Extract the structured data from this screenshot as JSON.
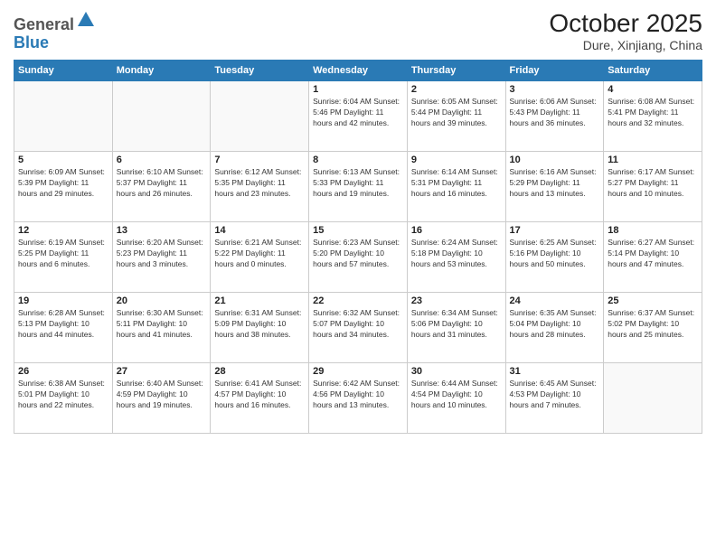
{
  "header": {
    "logo_general": "General",
    "logo_blue": "Blue",
    "month": "October 2025",
    "location": "Dure, Xinjiang, China"
  },
  "weekdays": [
    "Sunday",
    "Monday",
    "Tuesday",
    "Wednesday",
    "Thursday",
    "Friday",
    "Saturday"
  ],
  "weeks": [
    [
      {
        "day": "",
        "text": ""
      },
      {
        "day": "",
        "text": ""
      },
      {
        "day": "",
        "text": ""
      },
      {
        "day": "1",
        "text": "Sunrise: 6:04 AM\nSunset: 5:46 PM\nDaylight: 11 hours and 42 minutes."
      },
      {
        "day": "2",
        "text": "Sunrise: 6:05 AM\nSunset: 5:44 PM\nDaylight: 11 hours and 39 minutes."
      },
      {
        "day": "3",
        "text": "Sunrise: 6:06 AM\nSunset: 5:43 PM\nDaylight: 11 hours and 36 minutes."
      },
      {
        "day": "4",
        "text": "Sunrise: 6:08 AM\nSunset: 5:41 PM\nDaylight: 11 hours and 32 minutes."
      }
    ],
    [
      {
        "day": "5",
        "text": "Sunrise: 6:09 AM\nSunset: 5:39 PM\nDaylight: 11 hours and 29 minutes."
      },
      {
        "day": "6",
        "text": "Sunrise: 6:10 AM\nSunset: 5:37 PM\nDaylight: 11 hours and 26 minutes."
      },
      {
        "day": "7",
        "text": "Sunrise: 6:12 AM\nSunset: 5:35 PM\nDaylight: 11 hours and 23 minutes."
      },
      {
        "day": "8",
        "text": "Sunrise: 6:13 AM\nSunset: 5:33 PM\nDaylight: 11 hours and 19 minutes."
      },
      {
        "day": "9",
        "text": "Sunrise: 6:14 AM\nSunset: 5:31 PM\nDaylight: 11 hours and 16 minutes."
      },
      {
        "day": "10",
        "text": "Sunrise: 6:16 AM\nSunset: 5:29 PM\nDaylight: 11 hours and 13 minutes."
      },
      {
        "day": "11",
        "text": "Sunrise: 6:17 AM\nSunset: 5:27 PM\nDaylight: 11 hours and 10 minutes."
      }
    ],
    [
      {
        "day": "12",
        "text": "Sunrise: 6:19 AM\nSunset: 5:25 PM\nDaylight: 11 hours and 6 minutes."
      },
      {
        "day": "13",
        "text": "Sunrise: 6:20 AM\nSunset: 5:23 PM\nDaylight: 11 hours and 3 minutes."
      },
      {
        "day": "14",
        "text": "Sunrise: 6:21 AM\nSunset: 5:22 PM\nDaylight: 11 hours and 0 minutes."
      },
      {
        "day": "15",
        "text": "Sunrise: 6:23 AM\nSunset: 5:20 PM\nDaylight: 10 hours and 57 minutes."
      },
      {
        "day": "16",
        "text": "Sunrise: 6:24 AM\nSunset: 5:18 PM\nDaylight: 10 hours and 53 minutes."
      },
      {
        "day": "17",
        "text": "Sunrise: 6:25 AM\nSunset: 5:16 PM\nDaylight: 10 hours and 50 minutes."
      },
      {
        "day": "18",
        "text": "Sunrise: 6:27 AM\nSunset: 5:14 PM\nDaylight: 10 hours and 47 minutes."
      }
    ],
    [
      {
        "day": "19",
        "text": "Sunrise: 6:28 AM\nSunset: 5:13 PM\nDaylight: 10 hours and 44 minutes."
      },
      {
        "day": "20",
        "text": "Sunrise: 6:30 AM\nSunset: 5:11 PM\nDaylight: 10 hours and 41 minutes."
      },
      {
        "day": "21",
        "text": "Sunrise: 6:31 AM\nSunset: 5:09 PM\nDaylight: 10 hours and 38 minutes."
      },
      {
        "day": "22",
        "text": "Sunrise: 6:32 AM\nSunset: 5:07 PM\nDaylight: 10 hours and 34 minutes."
      },
      {
        "day": "23",
        "text": "Sunrise: 6:34 AM\nSunset: 5:06 PM\nDaylight: 10 hours and 31 minutes."
      },
      {
        "day": "24",
        "text": "Sunrise: 6:35 AM\nSunset: 5:04 PM\nDaylight: 10 hours and 28 minutes."
      },
      {
        "day": "25",
        "text": "Sunrise: 6:37 AM\nSunset: 5:02 PM\nDaylight: 10 hours and 25 minutes."
      }
    ],
    [
      {
        "day": "26",
        "text": "Sunrise: 6:38 AM\nSunset: 5:01 PM\nDaylight: 10 hours and 22 minutes."
      },
      {
        "day": "27",
        "text": "Sunrise: 6:40 AM\nSunset: 4:59 PM\nDaylight: 10 hours and 19 minutes."
      },
      {
        "day": "28",
        "text": "Sunrise: 6:41 AM\nSunset: 4:57 PM\nDaylight: 10 hours and 16 minutes."
      },
      {
        "day": "29",
        "text": "Sunrise: 6:42 AM\nSunset: 4:56 PM\nDaylight: 10 hours and 13 minutes."
      },
      {
        "day": "30",
        "text": "Sunrise: 6:44 AM\nSunset: 4:54 PM\nDaylight: 10 hours and 10 minutes."
      },
      {
        "day": "31",
        "text": "Sunrise: 6:45 AM\nSunset: 4:53 PM\nDaylight: 10 hours and 7 minutes."
      },
      {
        "day": "",
        "text": ""
      }
    ]
  ]
}
